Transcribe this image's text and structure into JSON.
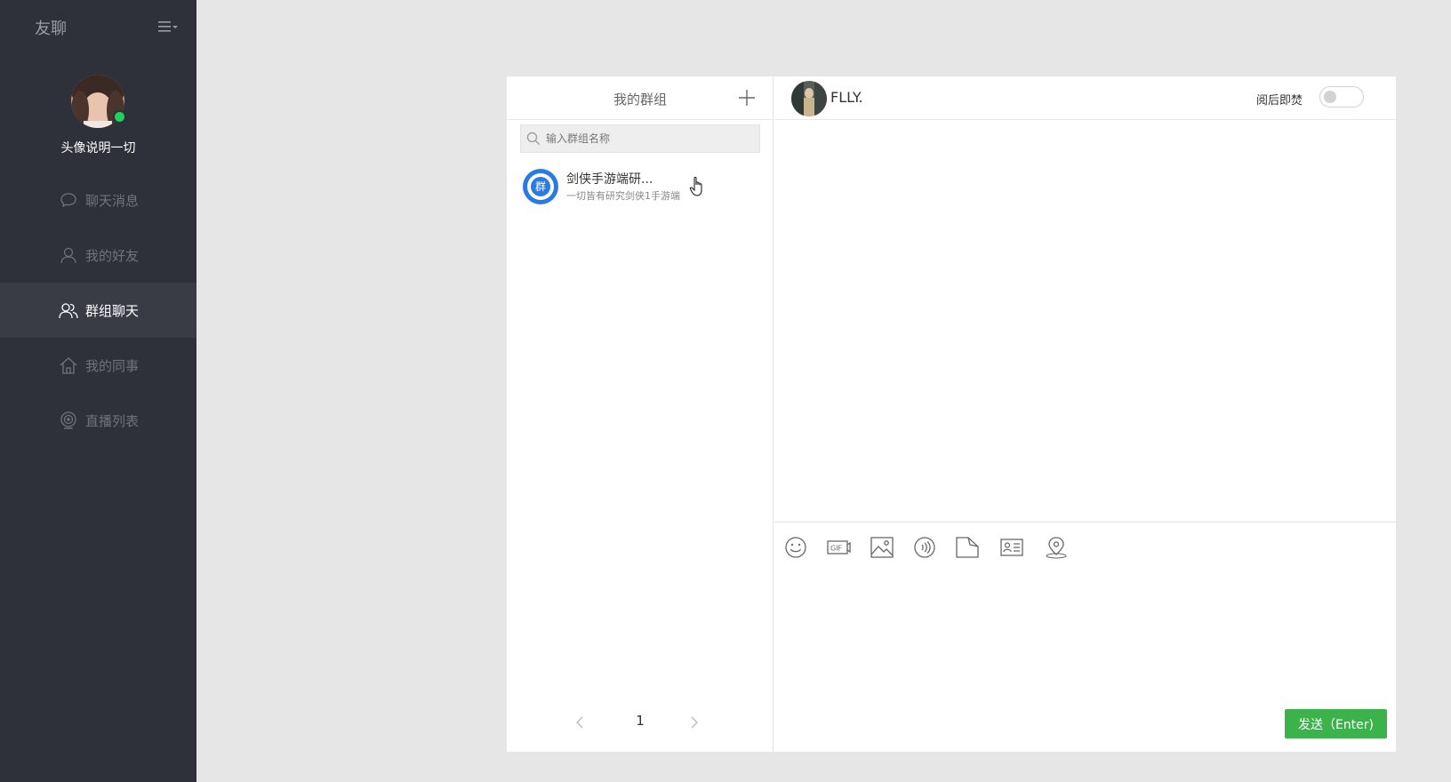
{
  "sidebar": {
    "brand": "友聊",
    "menu_icon": "menu-icon",
    "username": "头像说明一切",
    "status_color": "#22d05a",
    "items": [
      {
        "label": "聊天消息",
        "icon": "chat-bubble-icon",
        "active": false
      },
      {
        "label": "我的好友",
        "icon": "user-icon",
        "active": false
      },
      {
        "label": "群组聊天",
        "icon": "users-icon",
        "active": true
      },
      {
        "label": "我的同事",
        "icon": "home-icon",
        "active": false
      },
      {
        "label": "直播列表",
        "icon": "webcam-icon",
        "active": false
      }
    ]
  },
  "groups": {
    "title": "我的群组",
    "search_placeholder": "输入群组名称",
    "items": [
      {
        "avatar_text": "群",
        "name": "剑侠手游端研...",
        "desc": "一切皆有研究剑侠1手游端"
      }
    ],
    "pager": {
      "current": "1"
    }
  },
  "chat": {
    "contact_name": "FLLY.",
    "burn_after_read_label": "阅后即焚",
    "burn_after_read_on": false,
    "toolbar": [
      "emoji-icon",
      "gif-icon",
      "image-icon",
      "voice-icon",
      "file-icon",
      "card-icon",
      "location-icon"
    ],
    "send_label": "发送（Enter)"
  },
  "colors": {
    "sidebar_bg": "#2e313a",
    "sidebar_active_bg": "#393c45",
    "page_bg": "#e6e6e6",
    "accent_blue": "#2a7ae2",
    "send_green": "#3cb34a"
  }
}
